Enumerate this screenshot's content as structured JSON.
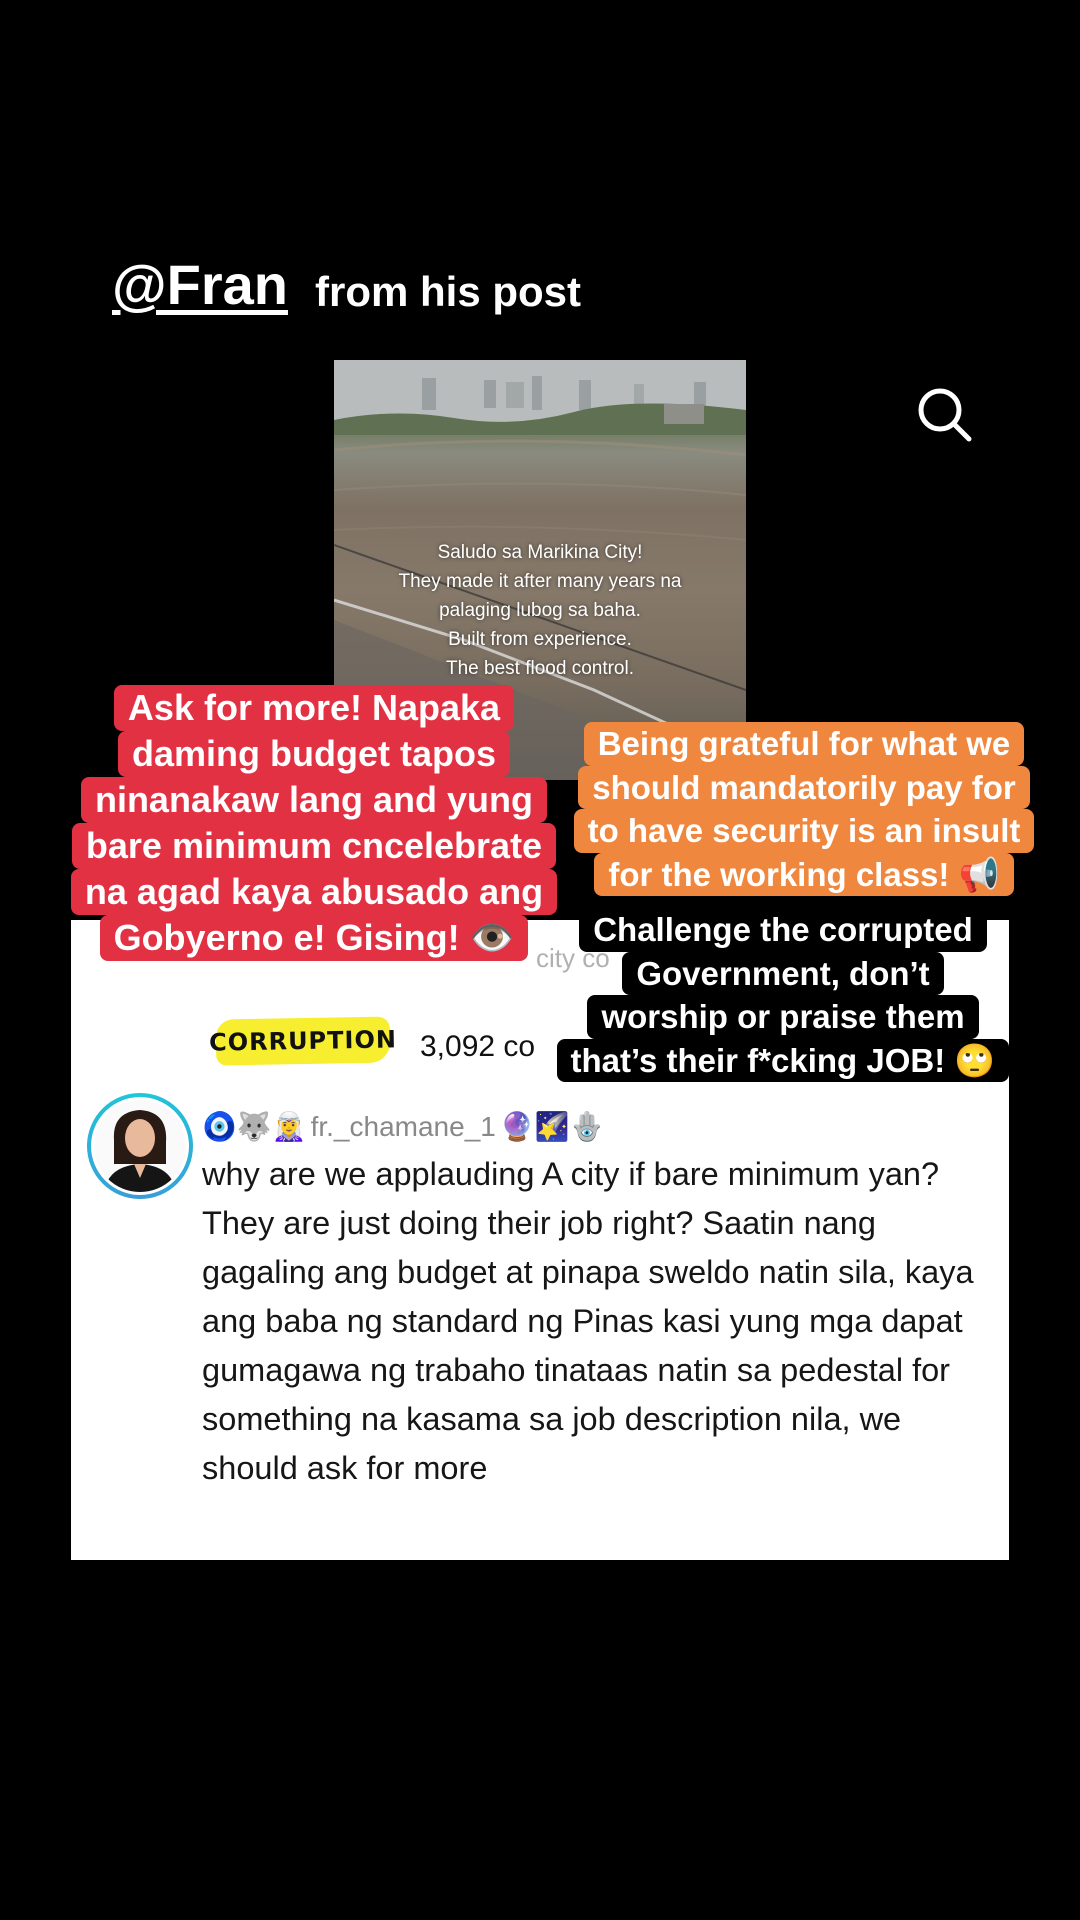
{
  "header": {
    "handle": "@Fran",
    "from_post": "from his post"
  },
  "icons": {
    "search": "search-icon"
  },
  "video": {
    "caption": "Saludo sa Marikina City!\nThey made it after many years na\npalaging lubog sa baha.\nBuilt from experience.\nThe best flood control."
  },
  "overlays": {
    "red": [
      "Ask for more! Napaka",
      "daming budget tapos",
      "ninanakaw lang and yung",
      "bare minimum cncelebrate",
      "na agad kaya abusado ang",
      "Gobyerno e! Gising! 👁️"
    ],
    "orange": [
      "Being grateful for what we",
      "should mandatorily pay for",
      "to have security is an insult",
      "for the working class! 📢"
    ],
    "black": [
      "Challenge the corrupted",
      "Government, don’t",
      "worship or praise them",
      "that’s their f*cking JOB! 🙄"
    ]
  },
  "card": {
    "ghost_text": "city co",
    "sticker": "CORRUPTION",
    "comment_count": "3,092 co",
    "comment": {
      "username_prefix_emojis": "🧿🐺🧝‍♀️",
      "username": "fr._chamane_1",
      "username_suffix_emojis": "🔮🌠🪬",
      "text": "why are we applauding A city if bare minimum yan? They are just doing their job right? Saatin nang gagaling ang budget at pinapa sweldo natin sila, kaya ang baba ng standard ng Pinas kasi yung mga dapat gumagawa ng trabaho tinataas natin sa pedestal for something na kasama sa job description nila, we should ask for more"
    }
  },
  "colors": {
    "red_caption": "#e13143",
    "orange_caption": "#f0873f",
    "sticker_yellow": "#f6ee2e",
    "avatar_ring": "#1ec8d8"
  }
}
